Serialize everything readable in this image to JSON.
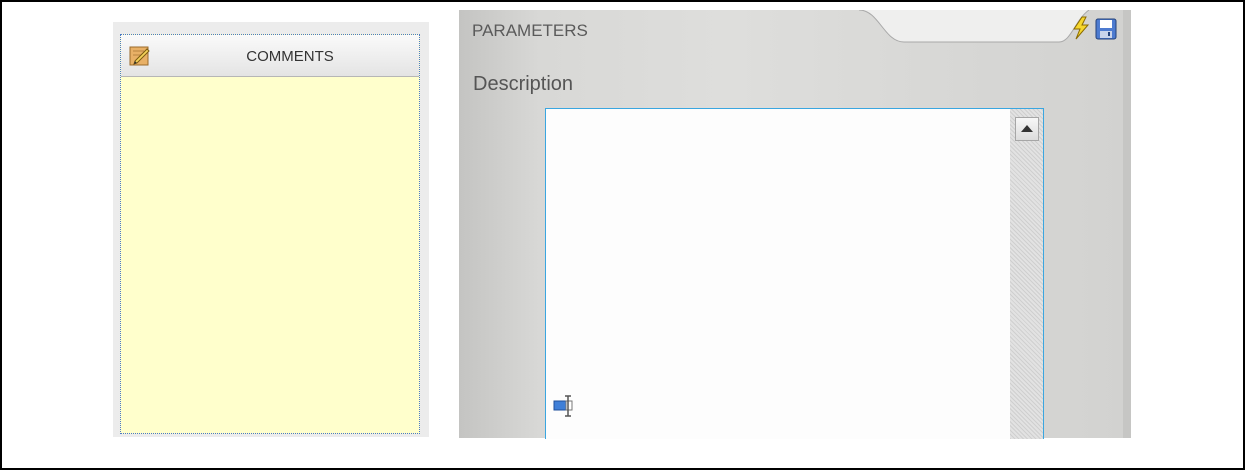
{
  "comments": {
    "title": "COMMENTS",
    "icon": "notepad-pencil-icon",
    "text": ""
  },
  "parameters": {
    "title": "PARAMETERS",
    "description_label": "Description",
    "description_value": "",
    "icons": [
      "lightning-icon",
      "save-icon"
    ]
  },
  "colors": {
    "comments_bg": "#ffffcc",
    "textarea_border": "#3aa6e0",
    "panel_bg": "#dededc"
  }
}
